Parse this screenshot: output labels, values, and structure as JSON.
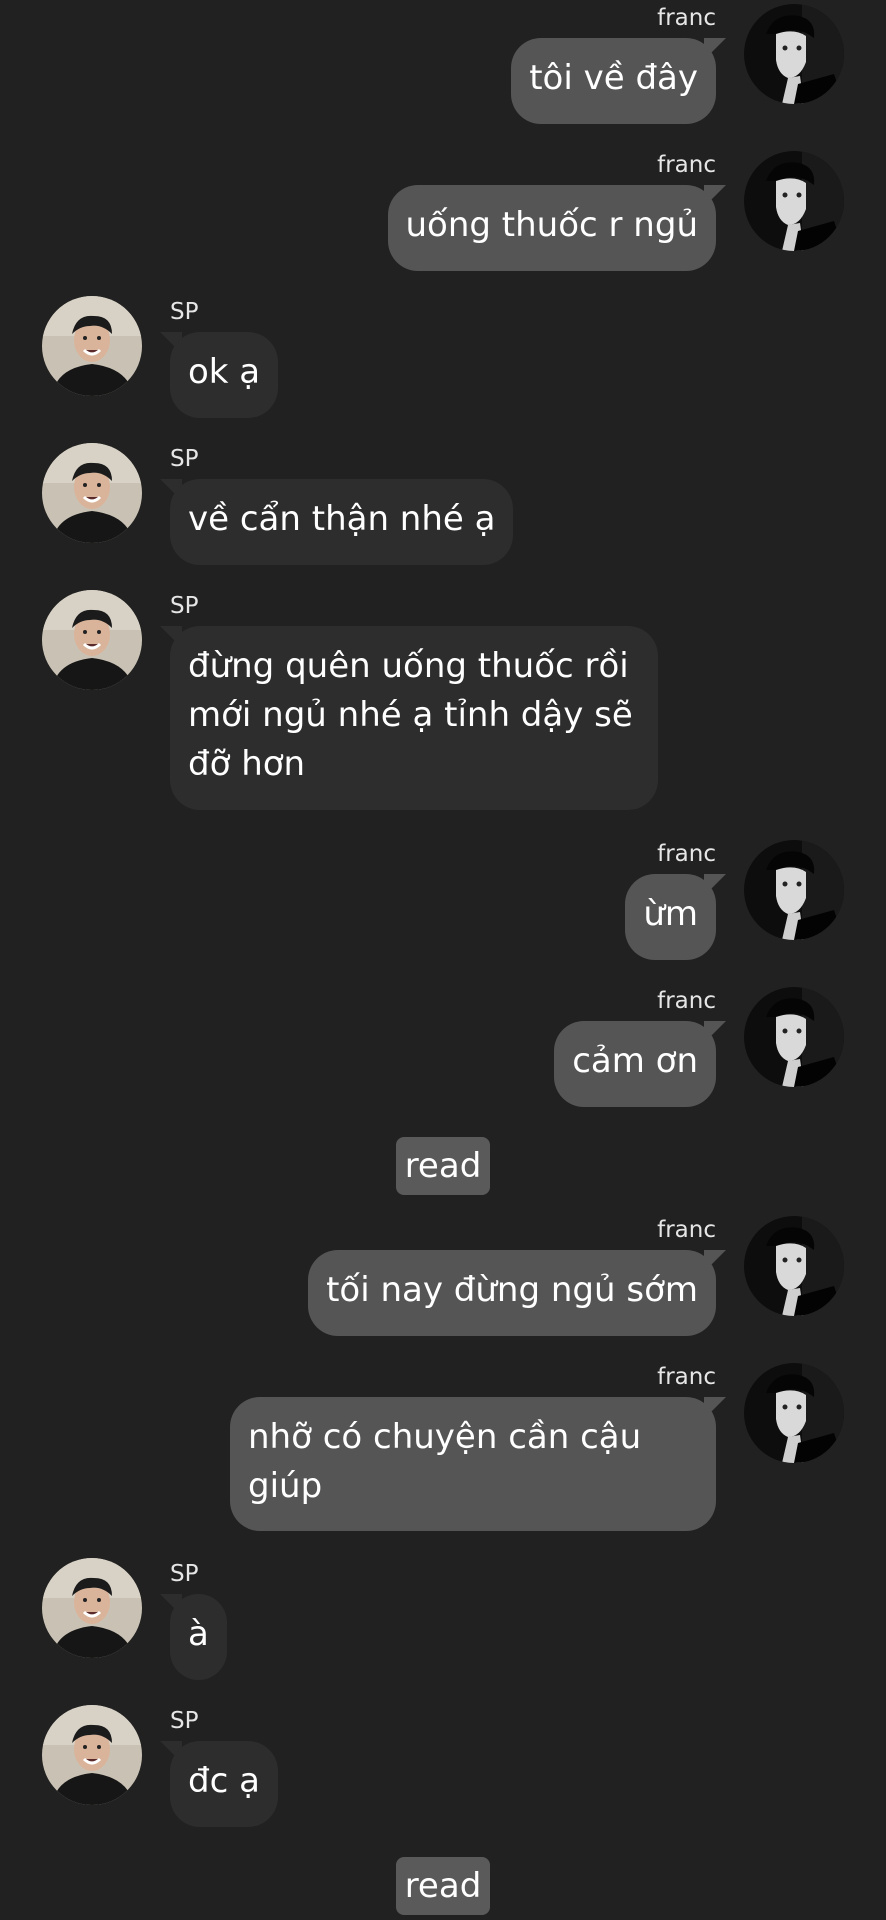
{
  "users": {
    "me": {
      "name": "franc"
    },
    "other": {
      "name": "SP"
    }
  },
  "messages": [
    {
      "sender": "franc",
      "text": "tôi về đây"
    },
    {
      "sender": "franc",
      "text": "uống thuốc r ngủ"
    },
    {
      "sender": "SP",
      "text": "ok ạ"
    },
    {
      "sender": "SP",
      "text": "về cẩn thận nhé ạ"
    },
    {
      "sender": "SP",
      "text": "đừng quên uống thuốc rồi\nmới ngủ nhé ạ tỉnh dậy sẽ\nđỡ hơn"
    },
    {
      "sender": "franc",
      "text": "ừm"
    },
    {
      "sender": "franc",
      "text": "cảm ơn"
    },
    {
      "sender": "franc",
      "text": "tối nay đừng ngủ sớm"
    },
    {
      "sender": "franc",
      "text": "nhỡ có chuyện cần cậu\ngiúp"
    },
    {
      "sender": "SP",
      "text": "à"
    },
    {
      "sender": "SP",
      "text": "đc ạ"
    }
  ],
  "read_receipts": [
    "read",
    "read"
  ],
  "colors": {
    "background": "#212121",
    "incoming_bubble": "#2d2d2d",
    "outgoing_bubble": "#555555",
    "read_badge": "#5a5a5a"
  },
  "icons": {
    "franc_avatar": "avatar-franc-icon",
    "sp_avatar": "avatar-sp-icon"
  }
}
